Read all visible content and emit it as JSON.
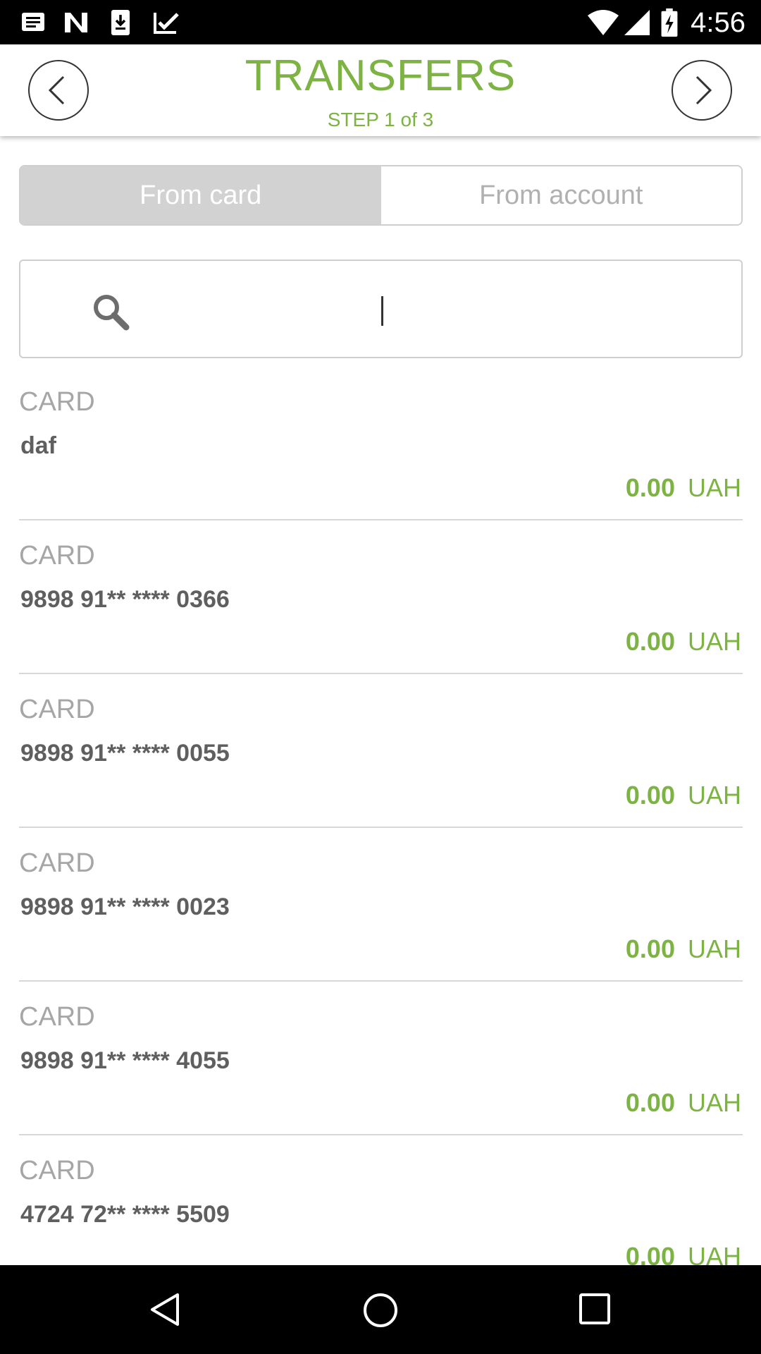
{
  "status_bar": {
    "time": "4:56"
  },
  "header": {
    "title": "TRANSFERS",
    "subtitle": "STEP 1 of 3"
  },
  "tabs": [
    {
      "label": "From card",
      "active": true
    },
    {
      "label": "From account",
      "active": false
    }
  ],
  "search": {
    "value": "",
    "placeholder": ""
  },
  "accounts": [
    {
      "type": "CARD",
      "name": "daf",
      "amount": "0.00",
      "currency": "UAH"
    },
    {
      "type": "CARD",
      "name": "9898 91** **** 0366",
      "amount": "0.00",
      "currency": "UAH"
    },
    {
      "type": "CARD",
      "name": "9898 91** **** 0055",
      "amount": "0.00",
      "currency": "UAH"
    },
    {
      "type": "CARD",
      "name": "9898 91** **** 0023",
      "amount": "0.00",
      "currency": "UAH"
    },
    {
      "type": "CARD",
      "name": "9898 91** **** 4055",
      "amount": "0.00",
      "currency": "UAH"
    },
    {
      "type": "CARD",
      "name": "4724 72** **** 5509",
      "amount": "0.00",
      "currency": "UAH"
    }
  ],
  "colors": {
    "accent": "#7cb342",
    "tab_active_bg": "#d2d2d2"
  },
  "icons": {
    "back": "chevron-left-icon",
    "forward": "chevron-right-icon",
    "search": "search-icon"
  }
}
